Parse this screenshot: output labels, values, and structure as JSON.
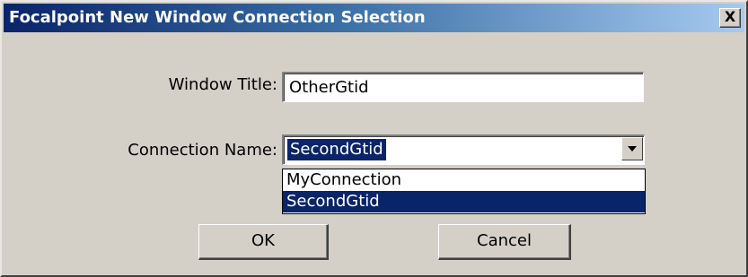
{
  "window": {
    "title": "Focalpoint New Window Connection Selection",
    "close_label": "X"
  },
  "form": {
    "window_title_label": "Window Title:",
    "window_title_value": "OtherGtid",
    "connection_name_label": "Connection Name:",
    "connection_name_value": "SecondGtid",
    "connection_options": [
      "MyConnection",
      "SecondGtid"
    ],
    "selected_option": "SecondGtid"
  },
  "buttons": {
    "ok_label": "OK",
    "cancel_label": "Cancel"
  },
  "icons": {
    "close": "close-icon",
    "dropdown": "chevron-down-icon"
  },
  "colors": {
    "titlebar_start": "#0a246a",
    "titlebar_end": "#a6caf0",
    "selection": "#0a246a",
    "face": "#d4d0c8"
  }
}
